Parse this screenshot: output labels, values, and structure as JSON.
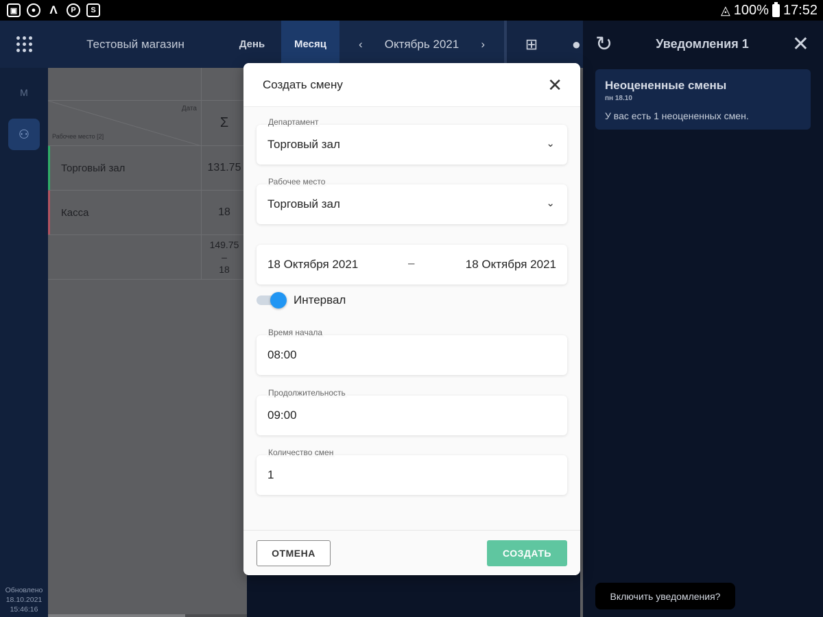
{
  "status_bar": {
    "icons": [
      "gallery-icon",
      "chrome-icon",
      "app-icon",
      "location-icon",
      "app-store-icon"
    ],
    "battery": "100%",
    "time": "17:52"
  },
  "appbar": {
    "store": "Тестовый магазин",
    "day": "День",
    "month": "Месяц",
    "prev": "‹",
    "period": "Октябрь 2021",
    "next": "›"
  },
  "rail": {
    "m": "М",
    "updated_line1": "Обновлено",
    "updated_line2": "18.10.2021",
    "updated_line3": "15:46:16"
  },
  "table": {
    "corner_date": "Дата",
    "corner_workplace": "Рабочее место [2]",
    "sigma": "Σ",
    "rows": [
      {
        "name": "Торговый зал",
        "value": "131.75"
      },
      {
        "name": "Касса",
        "value": "18"
      }
    ],
    "total_top": "149.75",
    "total_mid": "–",
    "total_bottom": "18"
  },
  "notifications": {
    "title": "Уведомления 1",
    "card_title": "Неоцененные смены",
    "card_date": "пн 18.10",
    "card_text": "У вас есть 1 неоцененных смен.",
    "enable": "Включить уведомления?"
  },
  "modal": {
    "title": "Создать смену",
    "department_label": "Департамент",
    "department_value": "Торговый зал",
    "workplace_label": "Рабочее место",
    "workplace_value": "Торговый зал",
    "date_from": "18 Октября 2021",
    "date_sep": "–",
    "date_to": "18 Октября 2021",
    "interval_label": "Интервал",
    "interval_on": true,
    "start_label": "Время начала",
    "start_value": "08:00",
    "duration_label": "Продолжительность",
    "duration_value": "09:00",
    "count_label": "Количество смен",
    "count_value": "1",
    "cancel": "ОТМЕНА",
    "create": "СОЗДАТЬ"
  }
}
